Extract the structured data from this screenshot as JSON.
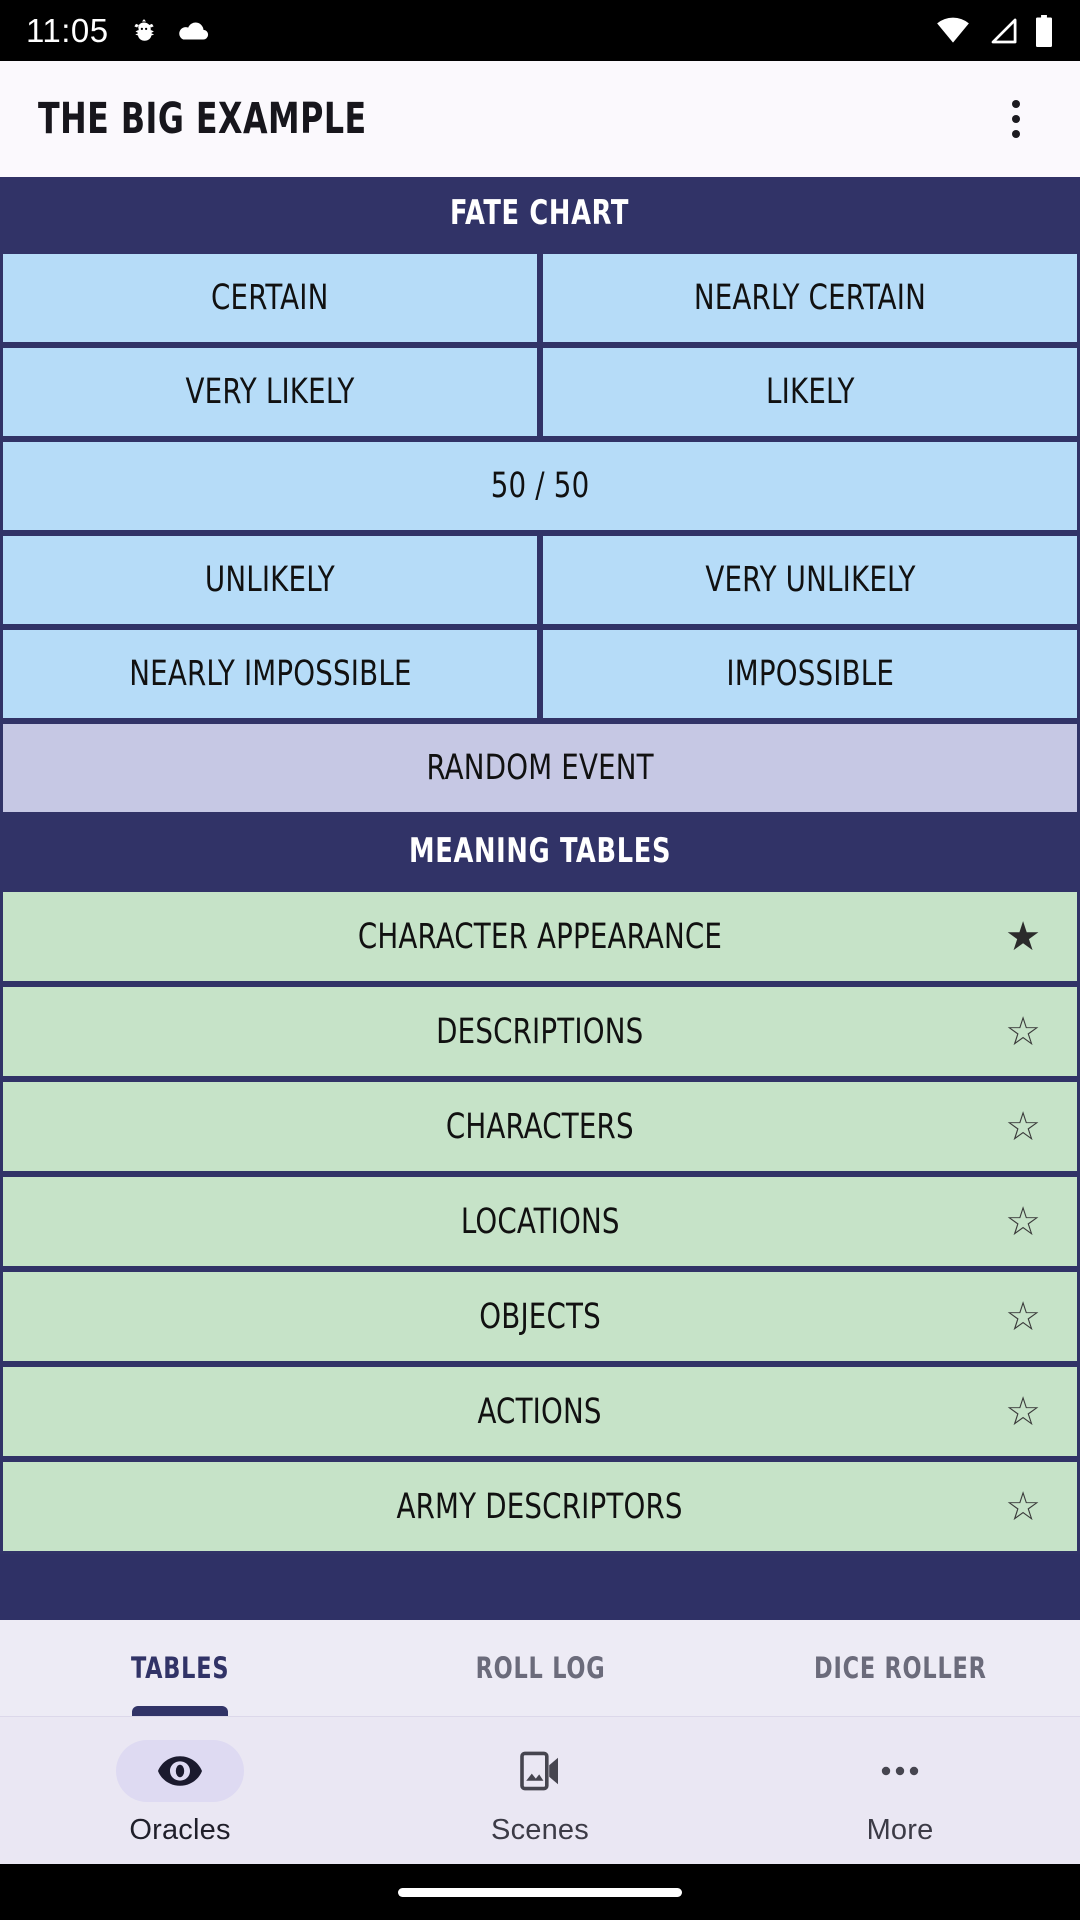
{
  "status_bar": {
    "time": "11:05",
    "left_icons": [
      "bug-icon",
      "cloud-icon"
    ],
    "right_icons": [
      "wifi-icon",
      "cellular-signal-icon",
      "battery-icon"
    ]
  },
  "app_bar": {
    "title": "THE BIG EXAMPLE",
    "overflow_icon": "more-vertical-icon"
  },
  "fate_chart": {
    "header": "FATE CHART",
    "odds": [
      {
        "label": "CERTAIN",
        "width": "half"
      },
      {
        "label": "NEARLY CERTAIN",
        "width": "half"
      },
      {
        "label": "VERY LIKELY",
        "width": "half"
      },
      {
        "label": "LIKELY",
        "width": "half"
      },
      {
        "label": "50 / 50",
        "width": "full"
      },
      {
        "label": "UNLIKELY",
        "width": "half"
      },
      {
        "label": "VERY UNLIKELY",
        "width": "half"
      },
      {
        "label": "NEARLY IMPOSSIBLE",
        "width": "half"
      },
      {
        "label": "IMPOSSIBLE",
        "width": "half"
      }
    ],
    "random_event": {
      "label": "RANDOM EVENT",
      "width": "full"
    }
  },
  "meaning_tables": {
    "header": "MEANING TABLES",
    "rows": [
      {
        "label": "CHARACTER APPEARANCE",
        "favorite": true,
        "star_icon": "star-filled-icon"
      },
      {
        "label": "DESCRIPTIONS",
        "favorite": false,
        "star_icon": "star-outline-icon"
      },
      {
        "label": "CHARACTERS",
        "favorite": false,
        "star_icon": "star-outline-icon"
      },
      {
        "label": "LOCATIONS",
        "favorite": false,
        "star_icon": "star-outline-icon"
      },
      {
        "label": "OBJECTS",
        "favorite": false,
        "star_icon": "star-outline-icon"
      },
      {
        "label": "ACTIONS",
        "favorite": false,
        "star_icon": "star-outline-icon"
      },
      {
        "label": "ARMY DESCRIPTORS",
        "favorite": false,
        "star_icon": "star-outline-icon"
      }
    ]
  },
  "tabs": [
    {
      "label": "TABLES",
      "active": true
    },
    {
      "label": "ROLL LOG",
      "active": false
    },
    {
      "label": "DICE ROLLER",
      "active": false
    }
  ],
  "bottom_nav": [
    {
      "label": "Oracles",
      "icon": "eye-icon",
      "active": true
    },
    {
      "label": "Scenes",
      "icon": "video-image-icon",
      "active": false
    },
    {
      "label": "More",
      "icon": "more-horizontal-icon",
      "active": false
    }
  ],
  "colors": {
    "navy": "#313367",
    "light_blue": "#B6DCF8",
    "lavender": "#C6C8E4",
    "green": "#C6E3C8",
    "tab_bg": "#EDEBF5",
    "nav_bg": "#EAE7F3",
    "app_bar_bg": "#FBF9FD",
    "star_filled": "#2B2B2B"
  }
}
